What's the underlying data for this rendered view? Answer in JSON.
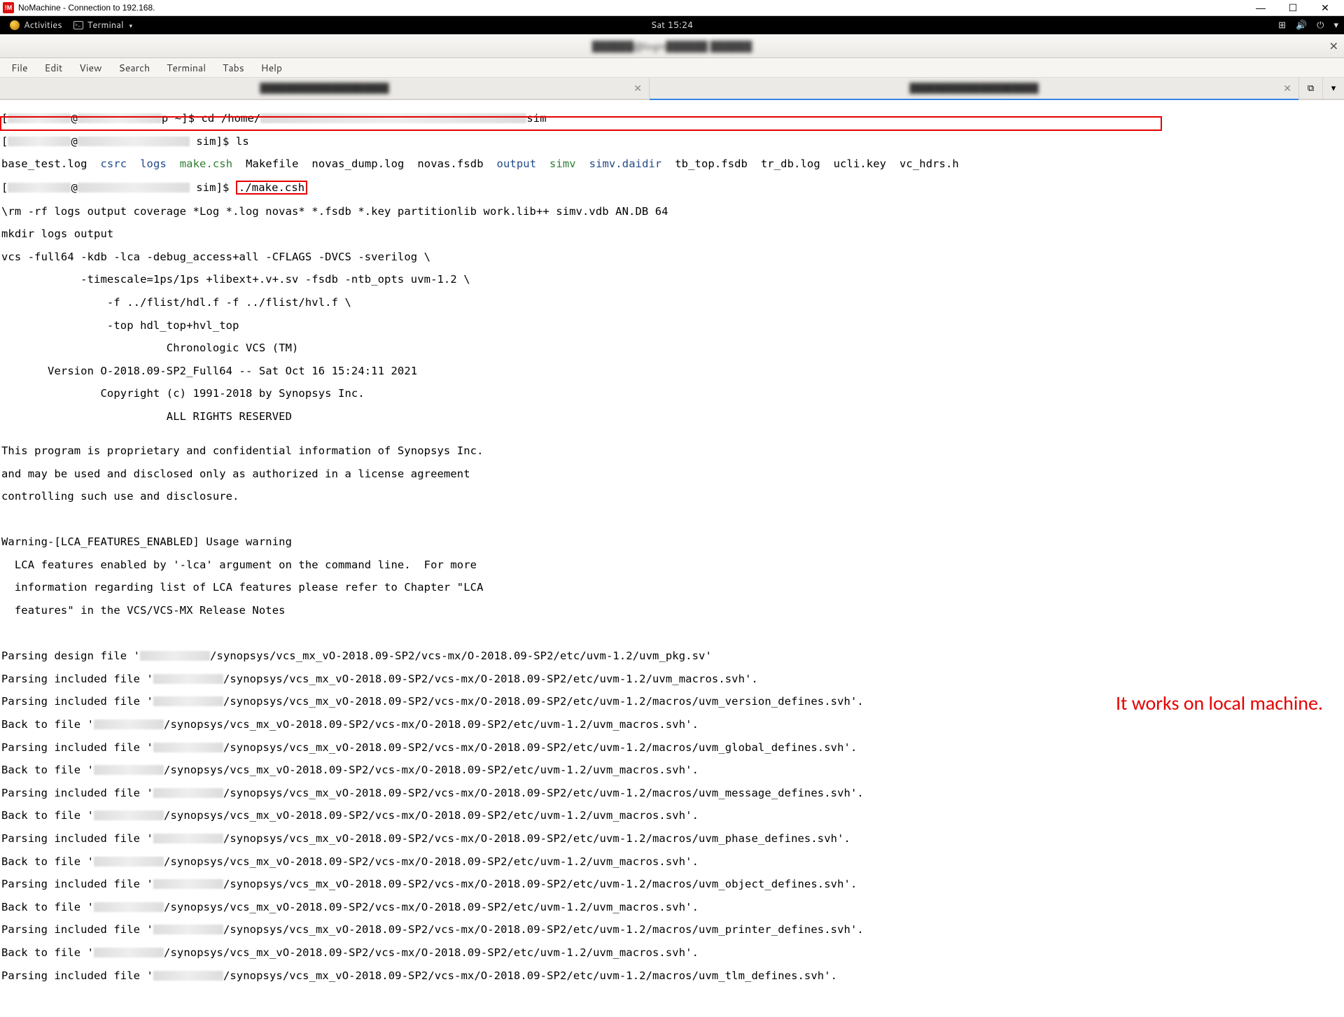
{
  "window": {
    "nx_badge": "!M",
    "title": "NoMachine - Connection to 192.168.",
    "min": "—",
    "max": "☐",
    "close": "✕"
  },
  "gnome": {
    "activities": "Activities",
    "terminal_label": "Terminal",
    "clock": "Sat 15:24",
    "net_icon": "⊞",
    "vol_icon": "🔊",
    "power_icon": "⏻",
    "chev": "▾"
  },
  "term_header": {
    "title_blur": "██████@login██████ ██████",
    "close": "✕"
  },
  "menubar": {
    "items": [
      "File",
      "Edit",
      "View",
      "Search",
      "Terminal",
      "Tabs",
      "Help"
    ]
  },
  "tabs": {
    "tab1_blur": "████████████████████",
    "tab2_blur": "████████████████████",
    "close": "✕",
    "new": "⧉",
    "drop": "▾"
  },
  "ls": {
    "f0": "base_test.log",
    "d0": "csrc",
    "d1": "logs",
    "e0": "make.csh",
    "f1": "Makefile",
    "f2": "novas_dump.log",
    "f3": "novas.fsdb",
    "d2": "output",
    "e1": "simv",
    "d3": "simv.daidir",
    "f4": "tb_top.fsdb",
    "f5": "tr_db.log",
    "f6": "ucli.key",
    "f7": "vc_hdrs.h"
  },
  "prompt": {
    "cd_line_a": "[",
    "cd_line_b": "@",
    "cd_line_c": "p ~]$ cd /home/",
    "cd_line_d": "sim",
    "ls_line_a": "[",
    "ls_line_b": "@",
    "ls_line_c": " sim]$ ls",
    "run_line_a": "[",
    "run_line_b": "@",
    "run_line_c": " sim]$ ",
    "run_cmd": "./make.csh"
  },
  "out": {
    "l0": "\\rm -rf logs output coverage *Log *.log novas* *.fsdb *.key partitionlib work.lib++ simv.vdb AN.DB 64",
    "l1": "mkdir logs output",
    "l2": "vcs -full64 -kdb -lca -debug_access+all -CFLAGS -DVCS -sverilog \\",
    "l3": "            -timescale=1ps/1ps +libext+.v+.sv -fsdb -ntb_opts uvm-1.2 \\",
    "l4": "                -f ../flist/hdl.f -f ../flist/hvl.f \\",
    "l5": "                -top hdl_top+hvl_top",
    "l6": "                         Chronologic VCS (TM)",
    "l7": "       Version O-2018.09-SP2_Full64 -- Sat Oct 16 15:24:11 2021",
    "l8": "               Copyright (c) 1991-2018 by Synopsys Inc.",
    "l9": "                         ALL RIGHTS RESERVED",
    "l10": "",
    "l11": "This program is proprietary and confidential information of Synopsys Inc.",
    "l12": "and may be used and disclosed only as authorized in a license agreement",
    "l13": "controlling such use and disclosure.",
    "l14": "",
    "l15": "",
    "l16": "Warning-[LCA_FEATURES_ENABLED] Usage warning",
    "l17": "  LCA features enabled by '-lca' argument on the command line.  For more ",
    "l18": "  information regarding list of LCA features please refer to Chapter \"LCA ",
    "l19": "  features\" in the VCS/VCS-MX Release Notes",
    "l20": "",
    "l21": "",
    "p_pre": "Parsing design file '",
    "p_pre2": "Parsing included file '",
    "p_back": "Back to file '",
    "path_suffix": {
      "s0": "/synopsys/vcs_mx_vO-2018.09-SP2/vcs-mx/O-2018.09-SP2/etc/uvm-1.2/uvm_pkg.sv'",
      "s1": "/synopsys/vcs_mx_vO-2018.09-SP2/vcs-mx/O-2018.09-SP2/etc/uvm-1.2/uvm_macros.svh'.",
      "s2": "/synopsys/vcs_mx_vO-2018.09-SP2/vcs-mx/O-2018.09-SP2/etc/uvm-1.2/macros/uvm_version_defines.svh'.",
      "s3": "/synopsys/vcs_mx_vO-2018.09-SP2/vcs-mx/O-2018.09-SP2/etc/uvm-1.2/uvm_macros.svh'.",
      "s4": "/synopsys/vcs_mx_vO-2018.09-SP2/vcs-mx/O-2018.09-SP2/etc/uvm-1.2/macros/uvm_global_defines.svh'.",
      "s5": "/synopsys/vcs_mx_vO-2018.09-SP2/vcs-mx/O-2018.09-SP2/etc/uvm-1.2/uvm_macros.svh'.",
      "s6": "/synopsys/vcs_mx_vO-2018.09-SP2/vcs-mx/O-2018.09-SP2/etc/uvm-1.2/macros/uvm_message_defines.svh'.",
      "s7": "/synopsys/vcs_mx_vO-2018.09-SP2/vcs-mx/O-2018.09-SP2/etc/uvm-1.2/uvm_macros.svh'.",
      "s8": "/synopsys/vcs_mx_vO-2018.09-SP2/vcs-mx/O-2018.09-SP2/etc/uvm-1.2/macros/uvm_phase_defines.svh'.",
      "s9": "/synopsys/vcs_mx_vO-2018.09-SP2/vcs-mx/O-2018.09-SP2/etc/uvm-1.2/uvm_macros.svh'.",
      "s10": "/synopsys/vcs_mx_vO-2018.09-SP2/vcs-mx/O-2018.09-SP2/etc/uvm-1.2/macros/uvm_object_defines.svh'.",
      "s11": "/synopsys/vcs_mx_vO-2018.09-SP2/vcs-mx/O-2018.09-SP2/etc/uvm-1.2/uvm_macros.svh'.",
      "s12": "/synopsys/vcs_mx_vO-2018.09-SP2/vcs-mx/O-2018.09-SP2/etc/uvm-1.2/macros/uvm_printer_defines.svh'.",
      "s13": "/synopsys/vcs_mx_vO-2018.09-SP2/vcs-mx/O-2018.09-SP2/etc/uvm-1.2/uvm_macros.svh'.",
      "s14": "/synopsys/vcs_mx_vO-2018.09-SP2/vcs-mx/O-2018.09-SP2/etc/uvm-1.2/macros/uvm_tlm_defines.svh'."
    }
  },
  "annotation": "It works on local machine."
}
